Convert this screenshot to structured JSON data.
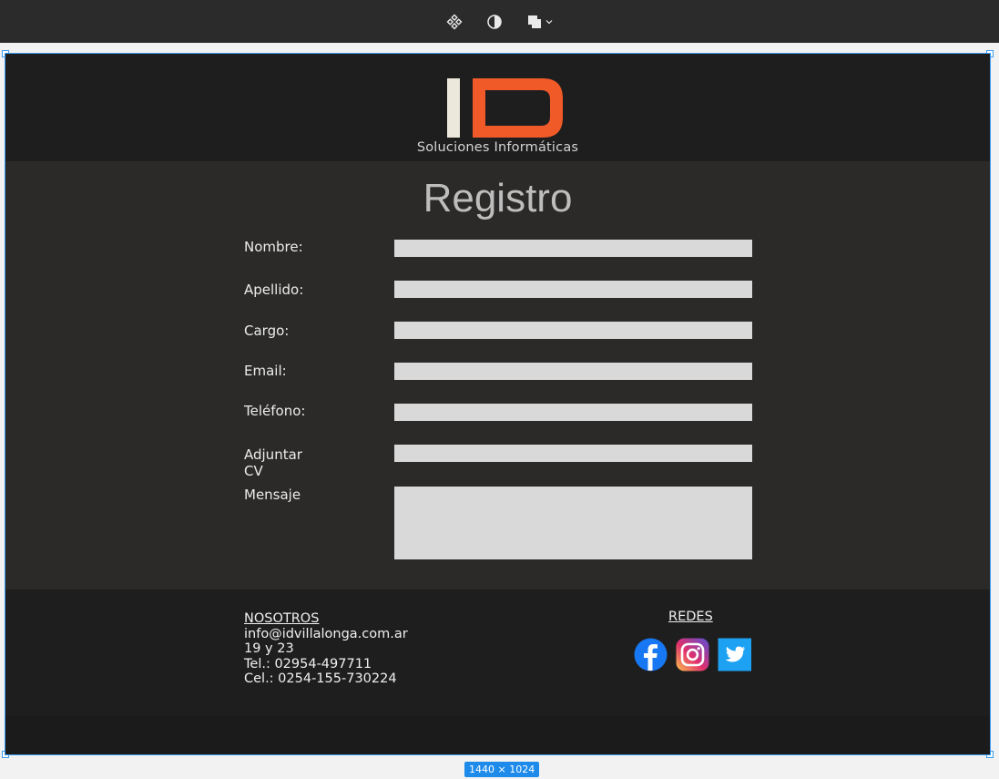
{
  "toolbar": {
    "icons": [
      "component-icon",
      "contrast-icon",
      "boolean-shapes-icon",
      "chevron-down-icon"
    ]
  },
  "header": {
    "logo_letters": "ID",
    "tagline": "Soluciones Informáticas"
  },
  "form": {
    "title": "Registro",
    "fields": [
      {
        "label": "Nombre:",
        "value": ""
      },
      {
        "label": "Apellido:",
        "value": ""
      },
      {
        "label": "Cargo:",
        "value": ""
      },
      {
        "label": "Email:",
        "value": ""
      },
      {
        "label": "Teléfono:",
        "value": ""
      },
      {
        "label": "Adjuntar CV",
        "value": ""
      },
      {
        "label": "Mensaje",
        "value": ""
      }
    ]
  },
  "footer": {
    "about_heading": "NOSOTROS",
    "email": "info@idvillalonga.com.ar",
    "address": "19 y 23",
    "phone": "Tel.: 02954-497711",
    "mobile": "Cel.: 0254-155-730224",
    "social_heading": "REDES",
    "social": [
      "facebook-icon",
      "instagram-icon",
      "twitter-icon"
    ]
  },
  "canvas": {
    "size_badge": "1440 × 1024"
  },
  "colors": {
    "accent": "#f05a28",
    "logo_bar": "#ede8dc",
    "selection": "#3b9cf0"
  }
}
